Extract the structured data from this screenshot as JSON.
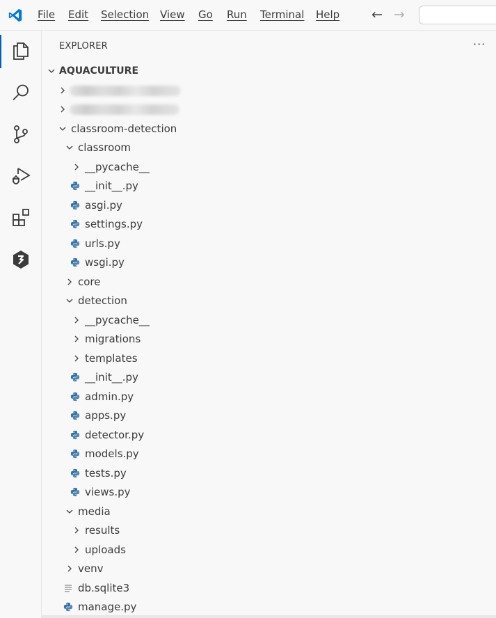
{
  "menu": [
    "File",
    "Edit",
    "Selection",
    "View",
    "Go",
    "Run",
    "Terminal",
    "Help"
  ],
  "nav": {
    "back_icon": "arrow-left-icon",
    "forward_icon": "arrow-right-icon"
  },
  "explorer": {
    "title": "EXPLORER",
    "more": "···"
  },
  "tree": [
    {
      "label": "AQUACULTURE",
      "type": "root",
      "depth": 0,
      "expanded": true
    },
    {
      "label": "",
      "type": "folder-redacted",
      "depth": 1,
      "expanded": false
    },
    {
      "label": "",
      "type": "folder-redacted",
      "depth": 1,
      "expanded": false
    },
    {
      "label": "classroom-detection",
      "type": "folder",
      "depth": 1,
      "expanded": true
    },
    {
      "label": "classroom",
      "type": "folder",
      "depth": 2,
      "expanded": true
    },
    {
      "label": "__pycache__",
      "type": "folder",
      "depth": 3,
      "expanded": false
    },
    {
      "label": "__init__.py",
      "type": "python",
      "depth": 3
    },
    {
      "label": "asgi.py",
      "type": "python",
      "depth": 3
    },
    {
      "label": "settings.py",
      "type": "python",
      "depth": 3
    },
    {
      "label": "urls.py",
      "type": "python",
      "depth": 3
    },
    {
      "label": "wsgi.py",
      "type": "python",
      "depth": 3
    },
    {
      "label": "core",
      "type": "folder",
      "depth": 2,
      "expanded": false
    },
    {
      "label": "detection",
      "type": "folder",
      "depth": 2,
      "expanded": true
    },
    {
      "label": "__pycache__",
      "type": "folder",
      "depth": 3,
      "expanded": false
    },
    {
      "label": "migrations",
      "type": "folder",
      "depth": 3,
      "expanded": false
    },
    {
      "label": "templates",
      "type": "folder",
      "depth": 3,
      "expanded": false
    },
    {
      "label": "__init__.py",
      "type": "python",
      "depth": 3
    },
    {
      "label": "admin.py",
      "type": "python",
      "depth": 3
    },
    {
      "label": "apps.py",
      "type": "python",
      "depth": 3
    },
    {
      "label": "detector.py",
      "type": "python",
      "depth": 3
    },
    {
      "label": "models.py",
      "type": "python",
      "depth": 3
    },
    {
      "label": "tests.py",
      "type": "python",
      "depth": 3
    },
    {
      "label": "views.py",
      "type": "python",
      "depth": 3
    },
    {
      "label": "media",
      "type": "folder",
      "depth": 2,
      "expanded": true
    },
    {
      "label": "results",
      "type": "folder",
      "depth": 3,
      "expanded": false
    },
    {
      "label": "uploads",
      "type": "folder",
      "depth": 3,
      "expanded": false
    },
    {
      "label": "venv",
      "type": "folder",
      "depth": 2,
      "expanded": false
    },
    {
      "label": "db.sqlite3",
      "type": "text",
      "depth": 2
    },
    {
      "label": "manage.py",
      "type": "python",
      "depth": 2
    }
  ],
  "colors": {
    "accent": "#005fb8",
    "vscode_blue": "#0078d4",
    "python_blue": "#3572a5",
    "python_yellow": "#ffd43b"
  }
}
